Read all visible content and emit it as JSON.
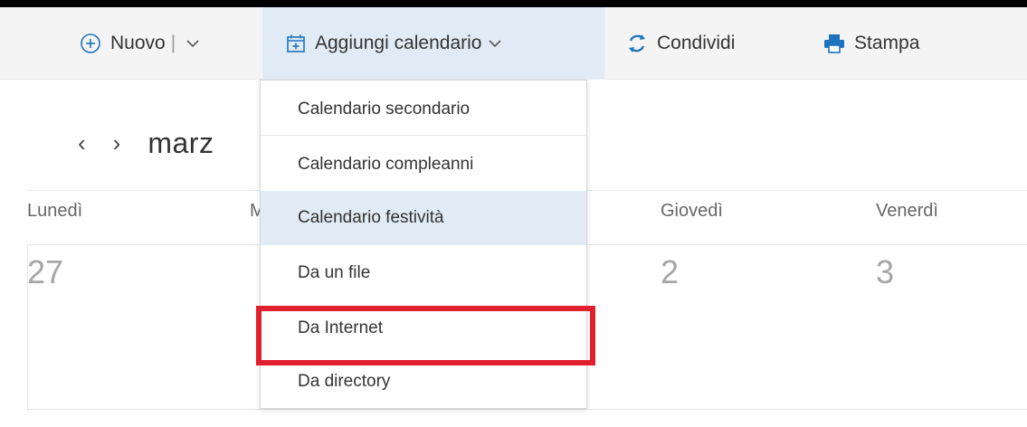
{
  "toolbar": {
    "new_label": "Nuovo",
    "separator": "|",
    "add_calendar_label": "Aggiungi calendario",
    "share_label": "Condividi",
    "print_label": "Stampa"
  },
  "nav": {
    "prev_glyph": "‹",
    "next_glyph": "›",
    "month_label": "marz"
  },
  "week_headers": [
    {
      "label": "Lunedì"
    },
    {
      "label": "M"
    },
    {
      "label": "Giovedì"
    },
    {
      "label": "Venerdì"
    }
  ],
  "day_numbers": {
    "monday": "27",
    "thursday": "2",
    "friday": "3"
  },
  "dropdown": {
    "items": [
      {
        "label": "Calendario secondario",
        "highlighted": false
      },
      {
        "label": "Calendario compleanni",
        "highlighted": false
      },
      {
        "label": "Calendario festività",
        "highlighted": true
      },
      {
        "label": "Da un file",
        "highlighted": false
      },
      {
        "label": "Da Internet",
        "highlighted": false
      },
      {
        "label": "Da directory",
        "highlighted": false
      }
    ]
  },
  "colors": {
    "accent": "#1e73be",
    "highlight_bg": "#e1ebf5",
    "annotation_red": "#e0202f"
  },
  "icons": {
    "new": "plus-circle-icon",
    "add_calendar": "calendar-add-icon",
    "share": "share-arrows-icon",
    "print": "printer-icon",
    "dropdown": "chevron-down-icon"
  }
}
